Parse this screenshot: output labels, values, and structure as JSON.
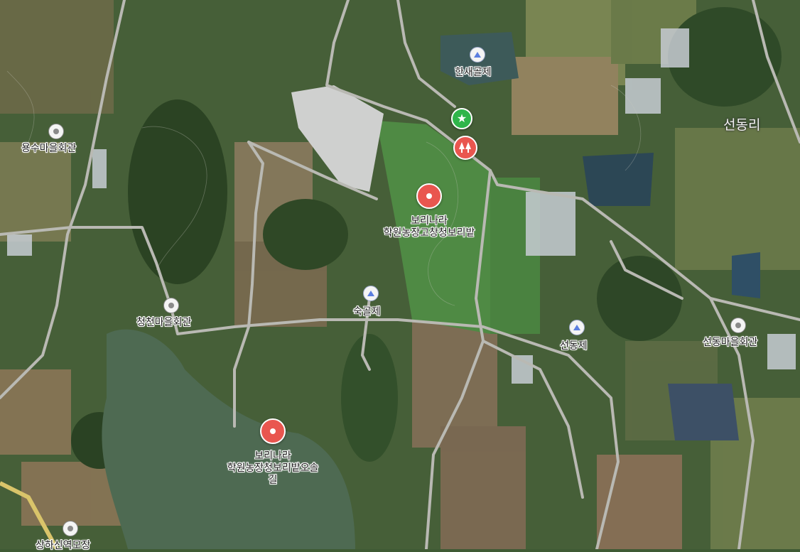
{
  "map": {
    "area_label": "선동리",
    "places": [
      {
        "id": "yongsu-hall",
        "label": "용수마을회관",
        "icon": "community-hall-icon"
      },
      {
        "id": "cheongcheon-hall",
        "label": "청천마을회관",
        "icon": "community-hall-icon"
      },
      {
        "id": "seondong-hall",
        "label": "선동마을회관",
        "icon": "community-hall-icon"
      },
      {
        "id": "sanghaseon-farm",
        "label": "상하신역모장",
        "icon": "community-hall-icon"
      },
      {
        "id": "hansaegol-reservoir",
        "label": "한새골제",
        "icon": "reservoir-icon"
      },
      {
        "id": "sukgol-reservoir",
        "label": "숙골제",
        "icon": "reservoir-icon"
      },
      {
        "id": "seondong-reservoir",
        "label": "선동제",
        "icon": "reservoir-icon"
      },
      {
        "id": "barley-field",
        "label": "보리나라\n학원농장고창청보리밭",
        "icon": "attraction-pin-icon"
      },
      {
        "id": "barley-trail",
        "label": "보리나라\n학원농장청보리밭오솔\n길",
        "icon": "attraction-pin-icon"
      }
    ],
    "markers": [
      {
        "id": "favorite",
        "icon": "star-icon",
        "color": "#2fb54a"
      },
      {
        "id": "forest",
        "icon": "trees-icon",
        "color": "#e9564f"
      }
    ]
  }
}
